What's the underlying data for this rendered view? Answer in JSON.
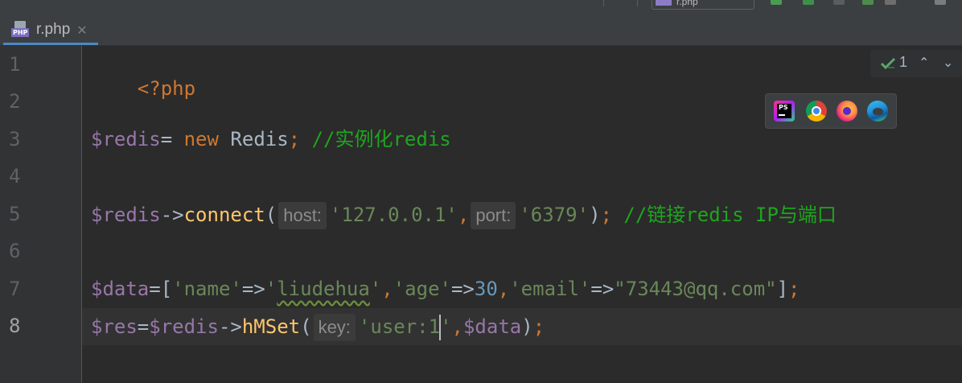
{
  "toolbar": {
    "run_config_label": "r.php"
  },
  "tab": {
    "file_icon_badge": "PHP",
    "label": "r.php",
    "close_glyph": "✕"
  },
  "gutter": {
    "line_numbers": [
      "1",
      "2",
      "3",
      "4",
      "5",
      "6",
      "7",
      "8"
    ],
    "active_line": "8"
  },
  "inspection": {
    "icon": "check-icon",
    "count": "1",
    "up_glyph": "⌃",
    "down_glyph": "⌄"
  },
  "browser_popup": {
    "icons": [
      "phpstorm-icon",
      "chrome-icon",
      "firefox-icon",
      "edge-icon"
    ],
    "ps_text": "PS"
  },
  "code": {
    "line1": {
      "open_tag": "<?php"
    },
    "line3": {
      "var": "$redis",
      "eq": "= ",
      "kw_new": "new",
      "cls": " Redis",
      "semi": ";",
      "comment": " //实例化redis"
    },
    "line5": {
      "var": "$redis",
      "arrow": "->",
      "method": "connect",
      "paren_open": "(",
      "hint_host": "host:",
      "host": "'127.0.0.1'",
      "comma": ",",
      "hint_port": "port:",
      "port": "'6379'",
      "paren_close": ")",
      "semi": ";",
      "comment": " //链接redis IP与端口"
    },
    "line7": {
      "var": "$data",
      "eq": "=[",
      "k1": "'name'",
      "arrow1": "=>",
      "v1q1": "'",
      "v1": "liudehua",
      "v1q2": "'",
      "c1": ",",
      "k2": "'age'",
      "arrow2": "=>",
      "v2": "30",
      "c2": ",",
      "k3": "'email'",
      "arrow3": "=>",
      "v3": "\"73443@qq.com\"",
      "close": "]",
      "semi": ";"
    },
    "line8": {
      "var1": "$res",
      "eq": "=",
      "var2": "$redis",
      "arrow": "->",
      "method": "hMSet",
      "paren_open": "(",
      "hint_key": "key:",
      "key_before_caret": "'user:1",
      "key_after_caret": "'",
      "comma": ",",
      "arg": "$data",
      "paren_close": ")",
      "semi": ";"
    }
  }
}
